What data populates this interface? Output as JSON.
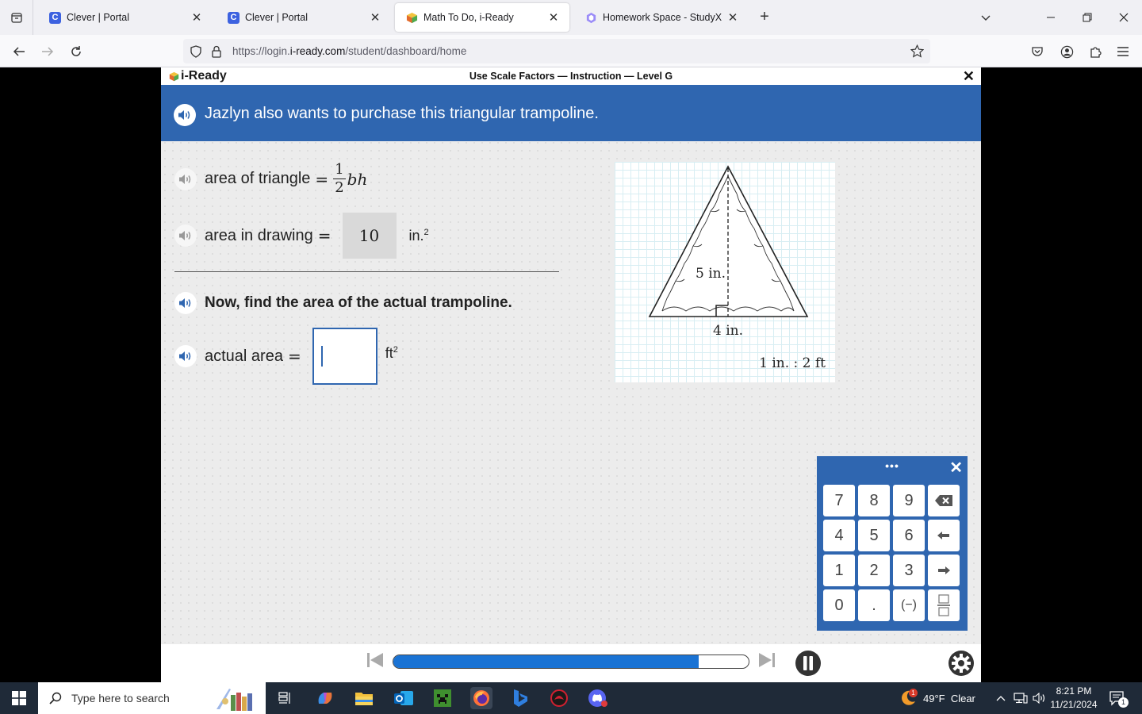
{
  "browser": {
    "tabs": [
      {
        "title": "Clever | Portal",
        "favicon": "C",
        "color": "#3d62e0",
        "active": false
      },
      {
        "title": "Clever | Portal",
        "favicon": "C",
        "color": "#3d62e0",
        "active": false
      },
      {
        "title": "Math To Do, i-Ready",
        "favicon": "cube",
        "color": "#e7a23a",
        "active": true
      },
      {
        "title": "Homework Space - StudyX",
        "favicon": "hex",
        "color": "#7b6ef6",
        "active": false
      }
    ],
    "url_prefix": "https://login.",
    "url_domain": "i-ready.com",
    "url_path": "/student/dashboard/home"
  },
  "lesson": {
    "logo": "i-Ready",
    "title": "Use Scale Factors — Instruction — Level G",
    "banner_text": "Jazlyn also wants to purchase this triangular trampoline.",
    "formula_label": "area of triangle",
    "formula_num": "1",
    "formula_den": "2",
    "formula_vars": "bh",
    "drawing_label": "area in drawing",
    "drawing_value": "10",
    "drawing_unit": "in.",
    "drawing_unit_exp": "2",
    "prompt": "Now, find the area of the actual trampoline.",
    "actual_label": "actual area",
    "actual_value": "",
    "actual_unit": "ft",
    "actual_unit_exp": "2"
  },
  "figure": {
    "height_label": "5 in.",
    "base_label": "4 in.",
    "scale_label": "1 in. : 2 ft"
  },
  "keypad": {
    "dots": "•••",
    "keys": [
      "7",
      "8",
      "9",
      "⌫",
      "4",
      "5",
      "6",
      "←",
      "1",
      "2",
      "3",
      "→",
      "0",
      ".",
      "(−)",
      "frac"
    ]
  },
  "controls": {
    "progress": 0.86
  },
  "taskbar": {
    "search_placeholder": "Type here to search",
    "weather": "49°F  Clear",
    "weather_badge": "1",
    "time": "8:21 PM",
    "date": "11/21/2024",
    "notif_count": "1"
  },
  "colors": {
    "accent": "#2f66b0",
    "progress_fill": "#1a73d4"
  }
}
